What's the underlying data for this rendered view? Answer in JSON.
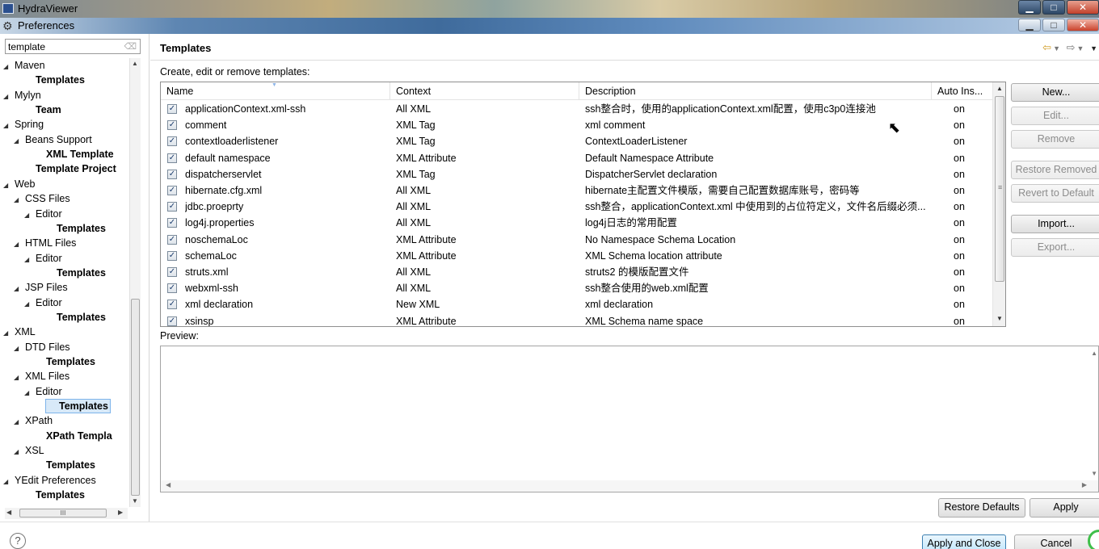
{
  "window": {
    "outer_title": "HydraViewer",
    "inner_title": "Preferences"
  },
  "filter": {
    "value": "template"
  },
  "tree": [
    {
      "label": "Maven",
      "level": 1,
      "twisty": "open",
      "bold": false
    },
    {
      "label": "Templates",
      "level": 3,
      "twisty": "none",
      "bold": true
    },
    {
      "label": "Mylyn",
      "level": 1,
      "twisty": "open",
      "bold": false
    },
    {
      "label": "Team",
      "level": 3,
      "twisty": "none",
      "bold": true
    },
    {
      "label": "Spring",
      "level": 1,
      "twisty": "open",
      "bold": false
    },
    {
      "label": "Beans Support",
      "level": 2,
      "twisty": "open",
      "bold": false
    },
    {
      "label": "XML Template",
      "level": 4,
      "twisty": "none",
      "bold": true
    },
    {
      "label": "Template Project",
      "level": 3,
      "twisty": "none",
      "bold": true
    },
    {
      "label": "Web",
      "level": 1,
      "twisty": "open",
      "bold": false
    },
    {
      "label": "CSS Files",
      "level": 2,
      "twisty": "open",
      "bold": false
    },
    {
      "label": "Editor",
      "level": 3,
      "twisty": "open",
      "bold": false
    },
    {
      "label": "Templates",
      "level": 5,
      "twisty": "none",
      "bold": true
    },
    {
      "label": "HTML Files",
      "level": 2,
      "twisty": "open",
      "bold": false
    },
    {
      "label": "Editor",
      "level": 3,
      "twisty": "open",
      "bold": false
    },
    {
      "label": "Templates",
      "level": 5,
      "twisty": "none",
      "bold": true
    },
    {
      "label": "JSP Files",
      "level": 2,
      "twisty": "open",
      "bold": false
    },
    {
      "label": "Editor",
      "level": 3,
      "twisty": "open",
      "bold": false
    },
    {
      "label": "Templates",
      "level": 5,
      "twisty": "none",
      "bold": true
    },
    {
      "label": "XML",
      "level": 1,
      "twisty": "open",
      "bold": false
    },
    {
      "label": "DTD Files",
      "level": 2,
      "twisty": "open",
      "bold": false
    },
    {
      "label": "Templates",
      "level": 4,
      "twisty": "none",
      "bold": true
    },
    {
      "label": "XML Files",
      "level": 2,
      "twisty": "open",
      "bold": false
    },
    {
      "label": "Editor",
      "level": 3,
      "twisty": "open",
      "bold": false
    },
    {
      "label": "Templates",
      "level": 5,
      "twisty": "none",
      "bold": true,
      "selected": true
    },
    {
      "label": "XPath",
      "level": 2,
      "twisty": "open",
      "bold": false
    },
    {
      "label": "XPath Templa",
      "level": 4,
      "twisty": "none",
      "bold": true
    },
    {
      "label": "XSL",
      "level": 2,
      "twisty": "open",
      "bold": false
    },
    {
      "label": "Templates",
      "level": 4,
      "twisty": "none",
      "bold": true
    },
    {
      "label": "YEdit Preferences",
      "level": 1,
      "twisty": "open",
      "bold": false
    },
    {
      "label": "Templates",
      "level": 3,
      "twisty": "none",
      "bold": true
    }
  ],
  "page": {
    "title": "Templates",
    "caption": "Create, edit or remove templates:",
    "preview_label": "Preview:"
  },
  "table": {
    "columns": [
      "Name",
      "Context",
      "Description",
      "Auto Ins..."
    ],
    "rows": [
      {
        "checked": true,
        "name": "applicationContext.xml-ssh",
        "context": "All XML",
        "description": "ssh整合时，使用的applicationContext.xml配置，使用c3p0连接池",
        "auto": "on"
      },
      {
        "checked": true,
        "name": "comment",
        "context": "XML Tag",
        "description": "xml comment",
        "auto": "on"
      },
      {
        "checked": true,
        "name": "contextloaderlistener",
        "context": "XML Tag",
        "description": "ContextLoaderListener",
        "auto": "on"
      },
      {
        "checked": true,
        "name": "default namespace",
        "context": "XML Attribute",
        "description": "Default Namespace Attribute",
        "auto": "on"
      },
      {
        "checked": true,
        "name": "dispatcherservlet",
        "context": "XML Tag",
        "description": "DispatcherServlet declaration",
        "auto": "on"
      },
      {
        "checked": true,
        "name": "hibernate.cfg.xml",
        "context": "All XML",
        "description": "hibernate主配置文件模版，需要自己配置数据库账号，密码等",
        "auto": "on"
      },
      {
        "checked": true,
        "name": "jdbc.proeprty",
        "context": "All XML",
        "description": "ssh整合，applicationContext.xml 中使用到的占位符定义，文件名后缀必须...",
        "auto": "on"
      },
      {
        "checked": true,
        "name": "log4j.properties",
        "context": "All XML",
        "description": "log4j日志的常用配置",
        "auto": "on"
      },
      {
        "checked": true,
        "name": "noschemaLoc",
        "context": "XML Attribute",
        "description": "No Namespace Schema Location",
        "auto": "on"
      },
      {
        "checked": true,
        "name": "schemaLoc",
        "context": "XML Attribute",
        "description": "XML Schema location attribute",
        "auto": "on"
      },
      {
        "checked": true,
        "name": "struts.xml",
        "context": "All XML",
        "description": "struts2 的模版配置文件",
        "auto": "on"
      },
      {
        "checked": true,
        "name": "webxml-ssh",
        "context": "All XML",
        "description": "ssh整合使用的web.xml配置",
        "auto": "on"
      },
      {
        "checked": true,
        "name": "xml declaration",
        "context": "New XML",
        "description": "xml declaration",
        "auto": "on"
      },
      {
        "checked": true,
        "name": "xsinsp",
        "context": "XML Attribute",
        "description": "XML Schema name space",
        "auto": "on"
      }
    ]
  },
  "side_buttons": [
    {
      "label": "New...",
      "enabled": true
    },
    {
      "label": "Edit...",
      "enabled": false
    },
    {
      "label": "Remove",
      "enabled": false
    },
    {
      "label": "Restore Removed",
      "enabled": false
    },
    {
      "label": "Revert to Default",
      "enabled": false
    },
    {
      "label": "Import...",
      "enabled": true
    },
    {
      "label": "Export...",
      "enabled": false
    }
  ],
  "buttons": {
    "restore_defaults": "Restore Defaults",
    "apply": "Apply",
    "apply_and_close": "Apply and Close",
    "cancel": "Cancel"
  },
  "icons": {
    "help": "?",
    "check": "✓"
  }
}
